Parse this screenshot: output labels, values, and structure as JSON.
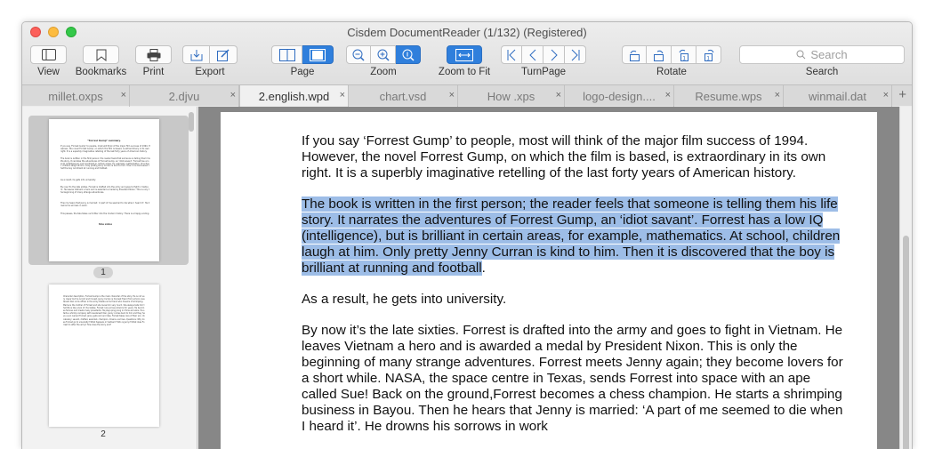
{
  "window": {
    "title": "Cisdem DocumentReader (1/132) (Registered)"
  },
  "toolbar": {
    "view": "View",
    "bookmarks": "Bookmarks",
    "print": "Print",
    "export": "Export",
    "page": "Page",
    "zoom": "Zoom",
    "zoom_to_fit": "Zoom to Fit",
    "turn_page": "TurnPage",
    "rotate": "Rotate",
    "search_label": "Search",
    "search_placeholder": "Search"
  },
  "tabs": [
    {
      "label": "millet.oxps",
      "active": false
    },
    {
      "label": "2.djvu",
      "active": false
    },
    {
      "label": "2.english.wpd",
      "active": true
    },
    {
      "label": "chart.vsd",
      "active": false
    },
    {
      "label": "How .xps",
      "active": false
    },
    {
      "label": "logo-design....",
      "active": false
    },
    {
      "label": "Resume.wps",
      "active": false
    },
    {
      "label": "winmail.dat",
      "active": false
    }
  ],
  "tab_close": "×",
  "tab_add": "+",
  "sidebar": {
    "thumb1": {
      "title": "\"Forrest Gump\" summary.",
      "paragraphs": [
        "If you say 'Forrest Gump' to people, most will think of the major film success of 1994. However, the novel Forrest Gump, on which the film is based, is extraordinary in its own right. It is a superbly imaginative retelling of the last forty years of American history.",
        "The book is written in the first person; the reader feels that someone is telling them his life story. It narrates the adventures of Forrest Gump, an 'idiot savant'. Forrest has a low IQ (intelligence), but is brilliant in certain areas, for example, mathematics. At school, children laugh at him. Only pretty Jenny Curran is kind to him. Then it is discovered that the boy is brilliant at running and football.",
        "As a result, he gets into university.",
        "By now it's the late sixties. Forrest is drafted into the army and goes to fight in Vietnam. He leaves Vietnam a hero and is awarded a medal by President Nixon. This is only the beginning of many strange adventures.",
        "Then he hears that Jenny is married: 'A part of me seemed to die when I heard it'. He drowns his sorrows in work.",
        "This passes, the tale takes us further into the modern history. There is a happy ending.",
        "Nina smiles"
      ],
      "page_number": "1"
    },
    "thumb2": {
      "lines": "Character description. Forrest Gump is the main character of the story. He is not very clever but he is kind and honest. Jenny Curran is his best friend from school. Lieutenant Dan is his officer in the army. Bubba is his friend who dreams of shrimping. Mama is the mother of Forrest and she loves him very much. She always tells him that life is like a box of chocolates. Forrest runs across America for years. He becomes famous and meets many presidents. He plays ping pong in China and wins. He starts a shrimp company with Lieutenant Dan. Jenny comes back to him and they have a son named Forrest. Jenny gets sick and dies. Forrest takes care of their son. Vocabulary: savant, drafted, awarded, champion, drowns, sorrows. Questions: Why does Forrest go to university? What happens in Vietnam? Who is Jenny? What does Forrest do after the army? How does the story end?",
      "page_number": "2"
    }
  },
  "document": {
    "para1": "If you say ‘Forrest Gump’ to people, most will think of the major film success of 1994. However, the novel Forrest Gump, on which the film is based, is extraordinary in its own right. It is a superbly imaginative retelling of the last forty years of American history.",
    "para2_highlighted": "The book is written in the first person; the reader feels that someone is telling them his life story. It narrates the adventures of Forrest Gump, an ‘idiot savant’. Forrest has a low IQ (intelligence), but is brilliant in certain areas, for example, mathematics. At school, children laugh at him. Only pretty Jenny Curran is kind to him. Then it is discovered that the boy is brilliant at running and football",
    "para2_tail": ".",
    "para3": "As a result, he gets into university.",
    "para4": "By now it’s the late sixties. Forrest is drafted into the army and goes to fight in Vietnam. He leaves Vietnam a hero and is awarded a medal by President Nixon. This is only the beginning of many strange adventures. Forrest meets Jenny again; they become lovers for a short while. NASA, the space centre in Texas, sends Forrest into space with an ape called Sue! Back on the ground,Forrest becomes a chess champion. He starts a shrimping business in Bayou. Then he hears that Jenny is married: ‘A part of me seemed to die when I heard it’. He drowns his sorrows in work"
  },
  "colors": {
    "accent": "#2f7fdc",
    "highlight": "#9dbde7",
    "content_bg": "#878787"
  }
}
